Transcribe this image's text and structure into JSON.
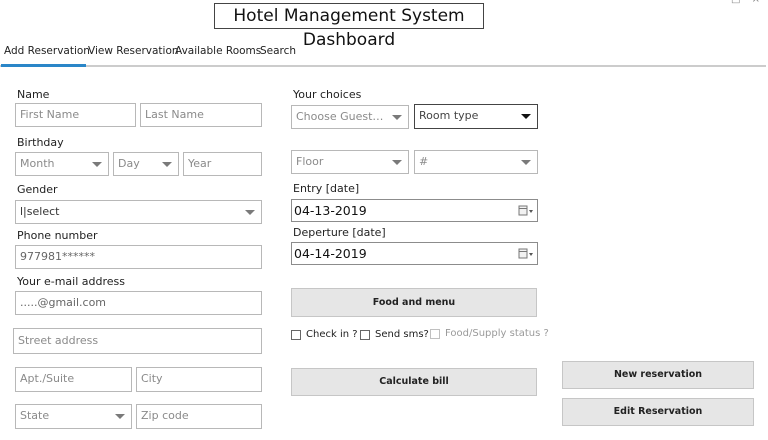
{
  "title": "Hotel Management System Dashboard",
  "window_controls": "− □ ×",
  "tabs": [
    "Add Reservation",
    "View Reservation",
    "Available Rooms",
    "Search"
  ],
  "form": {
    "name_label": "Name",
    "first_name_placeholder": "First Name",
    "last_name_placeholder": "Last Name",
    "birthday_label": "Birthday",
    "month": "Month",
    "day": "Day",
    "year_placeholder": "Year",
    "gender_label": "Gender",
    "gender_value": "l|select",
    "phone_label": "Phone number",
    "phone_value": "977981******",
    "email_label": "Your e-mail address",
    "email_value": ".....@gmail.com",
    "street_placeholder": "Street address",
    "apt_placeholder": "Apt./Suite",
    "city_placeholder": "City",
    "state": "State",
    "zip_placeholder": "Zip code"
  },
  "choices": {
    "label": "Your choices",
    "guests": "Choose Guest nu...",
    "room_type": "Room type",
    "floor": "Floor",
    "number": "#",
    "entry_label": "Entry [date]",
    "entry_value": "04-13-2019",
    "departure_label": "Deperture [date]",
    "departure_value": "04-14-2019",
    "food_button": "Food and menu",
    "check_in": "Check in ?",
    "send_sms": "Send sms?",
    "food_supply": "Food/Supply status ?",
    "calc_button": "Calculate bill"
  },
  "actions": {
    "new_reservation": "New reservation",
    "edit_reservation": "Edit Reservation"
  }
}
